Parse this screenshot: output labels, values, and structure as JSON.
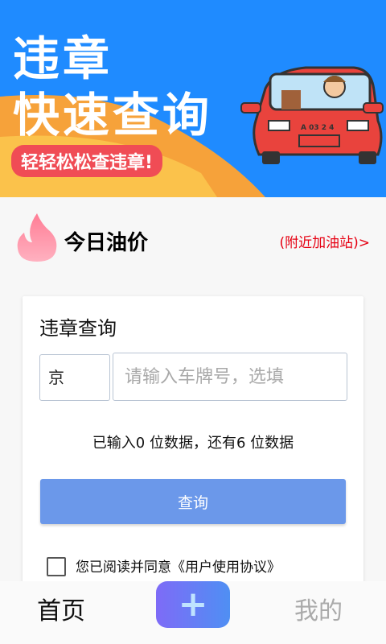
{
  "banner": {
    "title_line1": "违章",
    "title_line2": "快速查询",
    "tagline": "轻轻松松查违章!",
    "plate_sticker": "A 03 2 4"
  },
  "oil": {
    "title": "今日油价",
    "nearby_link": "(附近加油站)>"
  },
  "query_card": {
    "title": "违章查询",
    "province_value": "京",
    "plate_placeholder": "请输入车牌号，选填",
    "hint": "已输入0 位数据，还有6 位数据",
    "query_button": "查询",
    "agreement": "您已阅读并同意《用户使用协议》"
  },
  "nav": {
    "home": "首页",
    "plus": "+",
    "mine": "我的"
  },
  "colors": {
    "banner_blue": "#1f8bff",
    "accent_red": "#e60012",
    "button_blue": "#6b98ea"
  }
}
